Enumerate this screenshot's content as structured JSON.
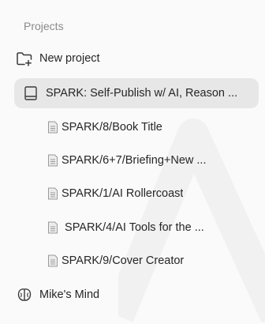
{
  "sidebar": {
    "section_label": "Projects",
    "new_project_label": "New project",
    "projects": [
      {
        "label": "SPARK: Self-Publish w/ AI, Reason ...",
        "icon": "book-icon",
        "selected": true,
        "children": [
          {
            "label": "SPARK/8/Book Title",
            "icon": "document-icon"
          },
          {
            "label": "SPARK/6+7/Briefing+New ...",
            "icon": "document-icon"
          },
          {
            "label": "SPARK/1/AI Rollercoast",
            "icon": "document-icon"
          },
          {
            "label": " SPARK/4/AI Tools for the ...",
            "icon": "document-icon"
          },
          {
            "label": "SPARK/9/Cover Creator",
            "icon": "document-icon"
          }
        ]
      },
      {
        "label": "Mike's Mind",
        "icon": "brain-icon",
        "selected": false
      }
    ]
  },
  "colors": {
    "selected_background": "#e7e7e7",
    "header_text": "#8a8a8a",
    "item_text": "#262626",
    "icon_stroke": "#3a3a3a"
  }
}
